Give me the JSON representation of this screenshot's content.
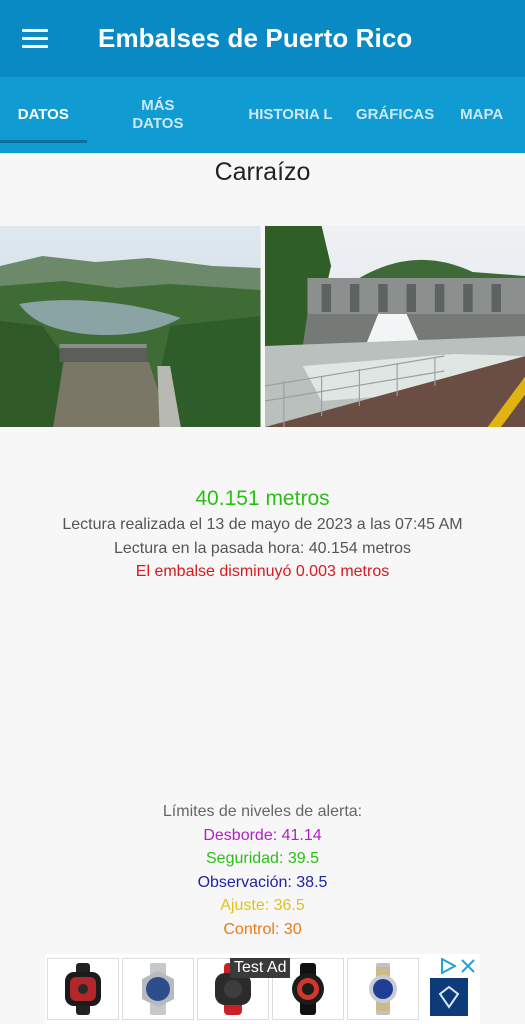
{
  "app": {
    "title": "Embalses de Puerto Rico"
  },
  "tabs": [
    {
      "label": "DATOS"
    },
    {
      "label": "MÁS DATOS"
    },
    {
      "label": "HISTORIA L"
    },
    {
      "label": "GRÁFICAS"
    },
    {
      "label": "MAPA"
    }
  ],
  "reservoir": {
    "name": "Carraízo",
    "level_value": "40.151 metros",
    "reading_time": "Lectura realizada el 13 de mayo de 2023 a las 07:45 AM",
    "last_hour": "Lectura en la pasada hora: 40.154 metros",
    "change": "El embalse disminuyó 0.003 metros"
  },
  "alerts": {
    "title": "Límites de niveles de alerta:",
    "desborde": "Desborde: 41.14",
    "seguridad": "Seguridad: 39.5",
    "observacion": "Observación: 38.5",
    "ajuste": "Ajuste: 36.5",
    "control": "Control: 30"
  },
  "ad": {
    "label": "Test Ad"
  },
  "colors": {
    "appbar": "#0a8ac4",
    "tabbar": "#119bd3",
    "level": "#2bbf16",
    "decrease": "#d7191c",
    "desborde": "#b21ec7",
    "observacion": "#1f24a6",
    "ajuste": "#e2c218",
    "control": "#ec7a11"
  },
  "icons": {
    "menu": "hamburger-menu-icon",
    "ad_choices": "ad-choices-icon",
    "ad_close": "close-icon"
  }
}
